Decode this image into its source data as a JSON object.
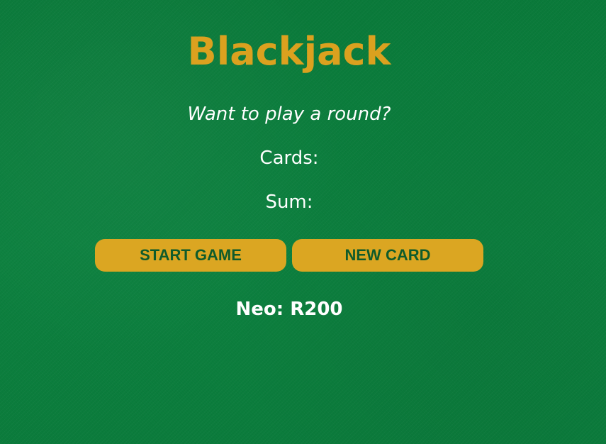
{
  "game": {
    "title": "Blackjack",
    "message": "Want to play a round?",
    "cards_label": "Cards:",
    "cards_value": "",
    "sum_label": "Sum:",
    "sum_value": "",
    "start_button": "START GAME",
    "new_card_button": "NEW CARD",
    "player_name": "Neo",
    "player_chips": "R200"
  },
  "colors": {
    "felt": "#0b7e3d",
    "title_gold": "#dba11f",
    "button_gold": "#dba622",
    "button_text": "#0f5b2b",
    "text": "#ffffff"
  }
}
